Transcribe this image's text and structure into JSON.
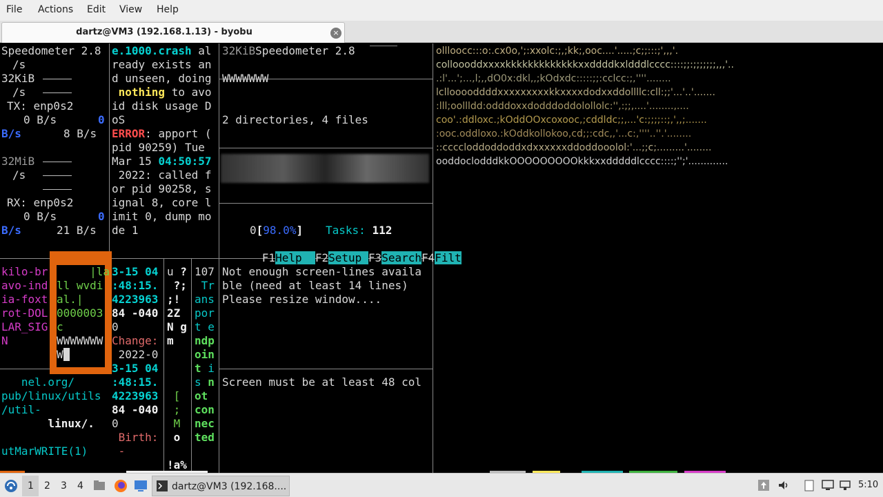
{
  "menubar": {
    "file": "File",
    "actions": "Actions",
    "edit": "Edit",
    "view": "View",
    "help": "Help"
  },
  "tab": {
    "title": "dartz@VM3 (192.168.1.13) - byobu",
    "close_glyph": "×"
  },
  "pane_a": {
    "speedometer": "Speedometer 2.8",
    "per_s": "/s",
    "kib_label": "32KiB",
    "tx_label": "TX: enp0s2",
    "tx_zero": "0 B/s",
    "tx_zero_scale": "0",
    "tx_bs_left": "B/s",
    "tx_bs_right": "8 B/s",
    "mib_label": "32MiB",
    "rx_label": "RX: enp0s2",
    "rx_zero": "0 B/s",
    "rx_zero_scale": "0",
    "rx_bs_left": "B/s",
    "rx_bs_right": "21 B/s"
  },
  "pane_b": {
    "l1a": "e.1000.crash",
    "l1b": " al",
    "l2": "ready exists an",
    "l3": "d unseen, doing",
    "l4a": " nothing",
    "l4b": " to avo",
    "l5": "id disk usage D",
    "l6": "oS",
    "l7a": "ERROR",
    "l7b": ": apport (",
    "l8": "pid 90259) Tue",
    "l9a": "Mar 15 ",
    "l9b": "04:50:57",
    "l10": " 2022: called f",
    "l11": "or pid 90258, s",
    "l12": "ignal 8, core l",
    "l13": "imit 0, dump mo",
    "l14": "de 1"
  },
  "pane_c": {
    "kib": "32KiB",
    "speedometer": "Speedometer 2.8",
    "www": "WWWWWWW",
    "tree_summary": "2 directories, 4 files",
    "cpu_num": "0",
    "cpu_open": "[",
    "cpu_pct": "98.0%",
    "cpu_close": "]",
    "tasks_label": "Tasks:",
    "tasks_value": "112",
    "f1": "F1",
    "f1_label": "Help  ",
    "f2": "F2",
    "f2_label": "Setup ",
    "f3": "F3",
    "f3_label": "Search",
    "f4": "F4",
    "f4_label": "Filt"
  },
  "pane_d": {
    "l1": "kilo-br",
    "l2": "avo-ind",
    "l3": "ia-foxt",
    "l4": "rot-DOL",
    "l5": "LAR_SIG",
    "l6": "N"
  },
  "pane_e": {
    "l1": "     |la",
    "l2": "ll wvdi",
    "l3": "al.|",
    "l4": "0000003",
    "l5": "c",
    "l6": "WWWWWWW",
    "l7": "W"
  },
  "pane_f": {
    "l1a": "3-15 ",
    "l1b": "04",
    "l2": ":48:15.",
    "l3": "4223963",
    "l4": "84 -040",
    "l5": "0",
    "l6": "Change:",
    "l7": " 2022-0",
    "l8a": "3-15 ",
    "l8b": "04",
    "l9": ":48:15.",
    "l10": "4223963",
    "l11": "84 -040",
    "l12": "0",
    "l13": " Birth:",
    "l14": " -"
  },
  "pane_g": {
    "l1a": "u ",
    "l1b": "?",
    "l2": " ?;",
    "l3": ";!",
    "l4": "2Z",
    "l5a": "N ",
    "l5b": "g",
    "l6": "m",
    "l7": " [",
    "l8": " ;",
    "l9": " M",
    "l10": " o",
    "l11": "!a%"
  },
  "pane_h": {
    "l1": "107",
    "l2": " Tr",
    "l3": "ans",
    "l4": "por",
    "l5": "t e",
    "l6": "ndp",
    "l7": "oin",
    "l8a": "t",
    "l8b": " i",
    "l9a": "s ",
    "l9b": "n",
    "l10": "ot",
    "l11": "con",
    "l12": "nec",
    "l13": "ted"
  },
  "pane_i": {
    "l1": "Not enough screen-lines availa",
    "l2": "ble (need at least 14 lines)",
    "l3": "Please resize window....",
    "l4": "Screen must be at least 48 col"
  },
  "pane_j": {
    "l1": "   nel.org/",
    "l2": "pub/linux/utils",
    "l3": "/util-",
    "l4": "       linux/.",
    "l5": "utMarWRITE(1)"
  },
  "ascii_art": [
    "ollloocc:::o:.cx0o,';:xxolc:;,;kk;,ooc....'.....;c;;:::;',,,'.",
    "colloooddxxxxkkkkkkkkkkkkkxxddddkxldddlcccc::::;;:;;;;;;;,,,'..",
    ".:l'...';...,l;,,dO0x:dkl,,;kOdxdc:::::;;:cclcc:;,''''........",
    "lcllooooddddxxxxxxxxxkkxxxxdodxxddollllc:cll:;;'...'..'.......",
    ":lll;oollldd:odddoxxdodddoddolollolc:'',:;;,....'........,....",
    "coo'.:ddloxc.;kOddOOxcoxooc,;cddldc;;,...'c:;;;;::;,',,;.......",
    ":ooc.oddloxo.:kOddkollokoo,cd;;:cdc,,'...c:,''''..''.'........",
    "::ccccloddoddoddxdxxxxxxddoddooolol:'...;;c;.........'........",
    "ooddoclodddkkOOOOOOOOOkkkxxdddddlcccc::::;'';'............."
  ],
  "ascii_colors": [
    "#bfae82",
    "#c2c2a0",
    "#9e9a7a",
    "#b5a982",
    "#a89a6a",
    "#b39a4e",
    "#a38c5a",
    "#b6aa86",
    "#d0d0d0"
  ],
  "taskbar": {
    "workspaces": [
      "1",
      "2",
      "3",
      "4"
    ],
    "task_label": "dartz@VM3 (192.168....",
    "clock": "5:10"
  }
}
